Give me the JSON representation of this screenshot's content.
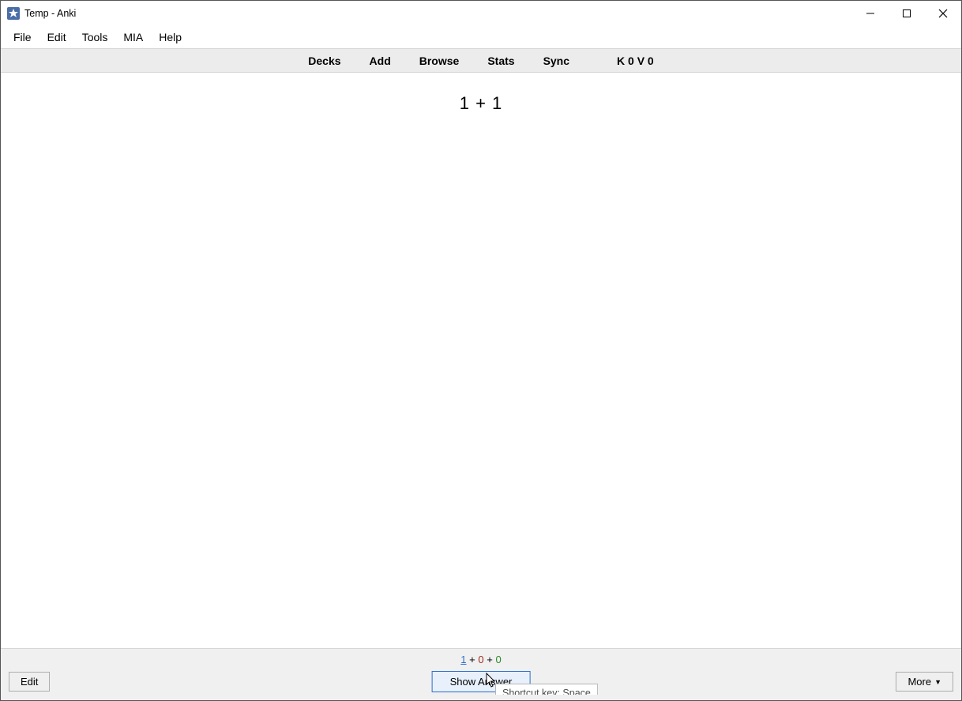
{
  "window": {
    "title": "Temp - Anki"
  },
  "menubar": {
    "items": [
      "File",
      "Edit",
      "Tools",
      "MIA",
      "Help"
    ]
  },
  "toolbar": {
    "decks": "Decks",
    "add": "Add",
    "browse": "Browse",
    "stats": "Stats",
    "sync": "Sync",
    "status": "K 0 V 0"
  },
  "card": {
    "question": "1 + 1"
  },
  "counts": {
    "new": "1",
    "sep": "+",
    "learn": "0",
    "review": "0"
  },
  "bottom": {
    "edit": "Edit",
    "show_answer": "Show Answer",
    "more": "More",
    "tooltip": "Shortcut key: Space"
  }
}
